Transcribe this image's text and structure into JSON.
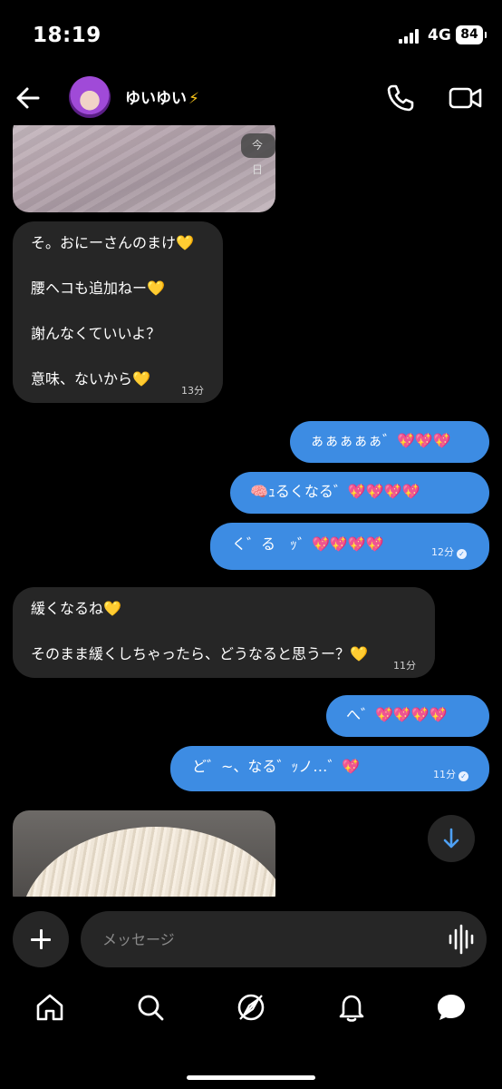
{
  "status_bar": {
    "time": "18:19",
    "network": "4G",
    "battery": "84"
  },
  "header": {
    "contact_name": "ゆいゆい",
    "contact_emoji": "⚡",
    "back_icon": "arrow-left-icon",
    "call_icon": "phone-icon",
    "video_icon": "video-camera-icon"
  },
  "chat": {
    "date_pill": "今日",
    "messages": [
      {
        "from": "them",
        "lines": [
          "そ。おにーさんのまけ💛",
          "腰ヘコも追加ねー💛",
          "謝んなくていいよ？",
          "意味、ないから💛"
        ],
        "time": "13分"
      },
      {
        "from": "me",
        "lines": [
          "ぁぁぁぁぁ゛💖💖💖"
        ],
        "time": ""
      },
      {
        "from": "me",
        "lines": [
          "🧠ｭるくなる゛💖💖💖💖"
        ],
        "time": ""
      },
      {
        "from": "me",
        "lines": [
          "く゛る　ｯ゛💖💖💖💖"
        ],
        "time": "12分"
      },
      {
        "from": "them",
        "lines": [
          "緩くなるね💛",
          "そのまま緩くしちゃったら、どうなると思うー？💛"
        ],
        "time": "11分"
      },
      {
        "from": "me",
        "lines": [
          "へ゛💖💖💖💖"
        ],
        "time": ""
      },
      {
        "from": "me",
        "lines": [
          "ど゛~、なる゛ｯノ…゛💖"
        ],
        "time": "11分"
      }
    ]
  },
  "composer": {
    "placeholder": "メッセージ",
    "add_icon": "plus-icon",
    "voice_icon": "voice-waveform-icon"
  },
  "bottom_nav": {
    "items": [
      "home-icon",
      "search-icon",
      "explore-compass-icon",
      "notifications-bell-icon",
      "messages-chat-icon"
    ]
  },
  "colors": {
    "background": "#000000",
    "received_bubble": "#262626",
    "sent_bubble": "#3d8ce3"
  }
}
